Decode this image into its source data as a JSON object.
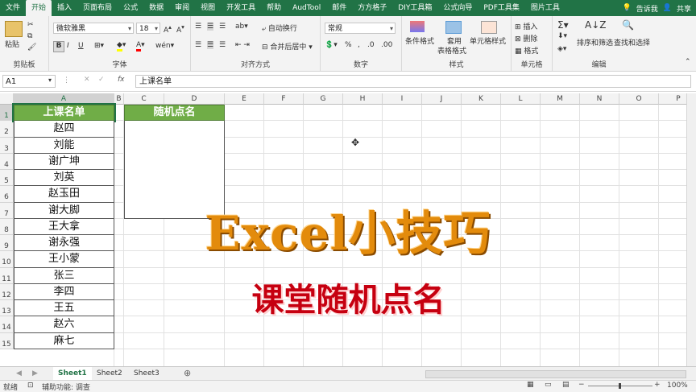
{
  "ribbon_tabs": [
    "文件",
    "开始",
    "插入",
    "页面布局",
    "公式",
    "数据",
    "审阅",
    "视图",
    "开发工具",
    "帮助",
    "AudTool",
    "邮件",
    "方方格子",
    "DIY工具箱",
    "公式向导",
    "PDF工具集",
    "图片工具"
  ],
  "active_tab_index": 1,
  "tell_me": "告诉我",
  "share": "共享",
  "clipboard": {
    "paste": "粘贴",
    "label": "剪贴板"
  },
  "font": {
    "name": "微软雅黑",
    "size": "18",
    "bold": "B",
    "italic": "I",
    "underline": "U",
    "label": "字体"
  },
  "alignment": {
    "wrap": "自动换行",
    "merge": "合并后居中",
    "label": "对齐方式"
  },
  "number": {
    "format": "常规",
    "label": "数字"
  },
  "styles": {
    "conditional": "条件格式",
    "table_line1": "套用",
    "table_line2": "表格格式",
    "cell_styles": "单元格样式",
    "label": "样式"
  },
  "cells": {
    "insert": "插入",
    "delete": "删除",
    "format": "格式",
    "label": "单元格"
  },
  "editing": {
    "sort": "排序和筛选",
    "find": "查找和选择",
    "label": "编辑"
  },
  "formula_bar": {
    "name_box": "A1",
    "fx": "fx",
    "content": "上课名单"
  },
  "columns": [
    "A",
    "B",
    "C",
    "D",
    "E",
    "F",
    "G",
    "H",
    "I",
    "J",
    "K",
    "L",
    "M",
    "N",
    "O",
    "P"
  ],
  "rows": [
    "1",
    "2",
    "3",
    "4",
    "5",
    "6",
    "7",
    "8",
    "9",
    "10",
    "11",
    "12",
    "13",
    "14",
    "15"
  ],
  "list_header": "上课名单",
  "names": [
    "赵四",
    "刘能",
    "谢广坤",
    "刘英",
    "赵玉田",
    "谢大脚",
    "王大拿",
    "谢永强",
    "王小蒙",
    "张三",
    "李四",
    "王五",
    "赵六",
    "麻七"
  ],
  "random_header": "随机点名",
  "overlay_title": "Excel小技巧",
  "overlay_subtitle": "课堂随机点名",
  "sheets": [
    "Sheet1",
    "Sheet2",
    "Sheet3"
  ],
  "add_sheet": "⊕",
  "status": {
    "ready": "就绪",
    "accessibility": "辅助功能: 调查",
    "zoom": "100%"
  },
  "colors": {
    "excel_green": "#217346",
    "header_green": "#70ad47",
    "title_orange": "#e38b0c",
    "subtitle_red": "#c60010"
  }
}
